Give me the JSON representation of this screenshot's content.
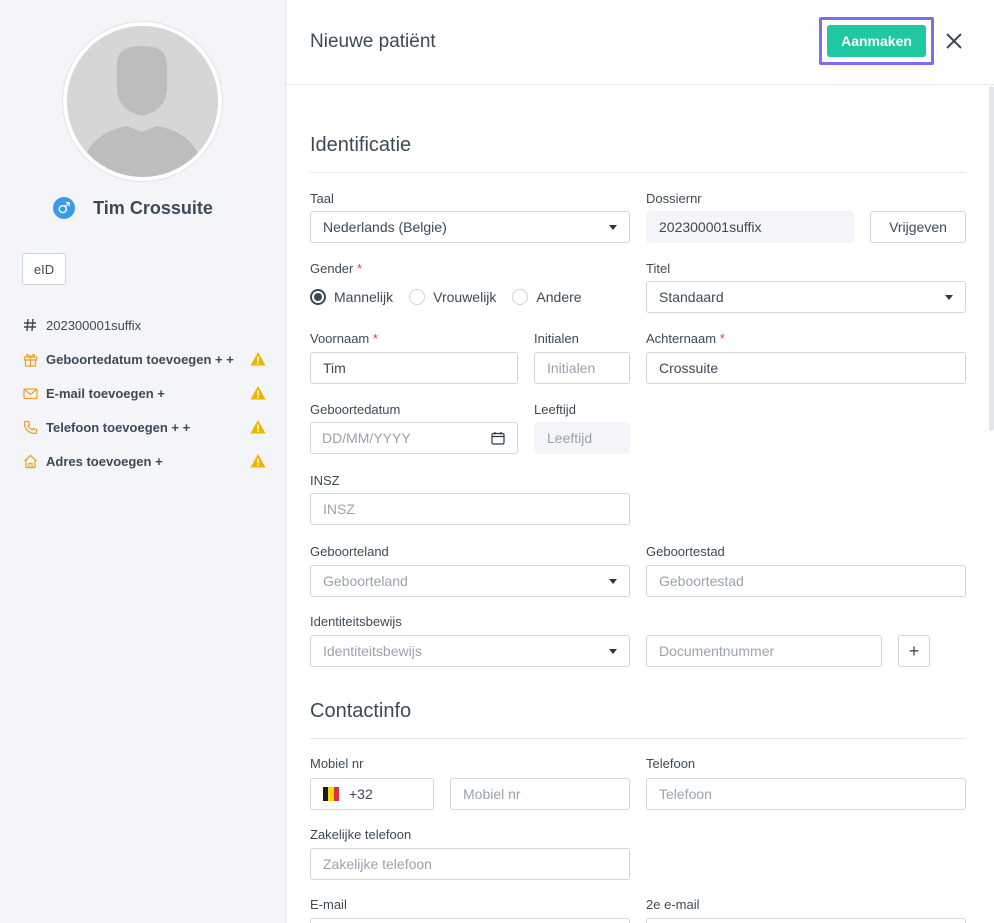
{
  "sidebar": {
    "patient_name": "Tim Crossuite",
    "gender_symbol": "♂",
    "eid_label": "eID",
    "items": [
      {
        "icon": "hash-icon",
        "label": "202300001suffix",
        "warning": false,
        "bold": false
      },
      {
        "icon": "gift-icon",
        "label": "Geboortedatum toevoegen + +",
        "warning": true,
        "bold": true
      },
      {
        "icon": "mail-icon",
        "label": "E-mail toevoegen +",
        "warning": true,
        "bold": true
      },
      {
        "icon": "phone-icon",
        "label": "Telefoon toevoegen + +",
        "warning": true,
        "bold": true
      },
      {
        "icon": "home-icon",
        "label": "Adres toevoegen +",
        "warning": true,
        "bold": true
      }
    ]
  },
  "header": {
    "title": "Nieuwe patiënt",
    "create_label": "Aanmaken"
  },
  "identification": {
    "title": "Identificatie",
    "language": {
      "label": "Taal",
      "value": "Nederlands (Belgie)"
    },
    "file_nr": {
      "label": "Dossiernr",
      "value": "202300001suffix",
      "release_label": "Vrijgeven"
    },
    "gender": {
      "label": "Gender",
      "required": "*",
      "options": [
        "Mannelijk",
        "Vrouwelijk",
        "Andere"
      ],
      "selected": "Mannelijk"
    },
    "title_field": {
      "label": "Titel",
      "value": "Standaard"
    },
    "first_name": {
      "label": "Voornaam",
      "required": "*",
      "value": "Tim"
    },
    "initials": {
      "label": "Initialen",
      "placeholder": "Initialen"
    },
    "last_name": {
      "label": "Achternaam",
      "required": "*",
      "value": "Crossuite"
    },
    "birth_date": {
      "label": "Geboortedatum",
      "placeholder": "DD/MM/YYYY"
    },
    "age": {
      "label": "Leeftijd",
      "placeholder": "Leeftijd"
    },
    "insz": {
      "label": "INSZ",
      "placeholder": "INSZ"
    },
    "birth_country": {
      "label": "Geboorteland",
      "placeholder": "Geboorteland"
    },
    "birth_place": {
      "label": "Geboortestad",
      "placeholder": "Geboortestad"
    },
    "id_card": {
      "label": "Identiteitsbewijs",
      "placeholder": "Identiteitsbewijs"
    },
    "doc_nr": {
      "placeholder": "Documentnummer"
    },
    "add_symbol": "+"
  },
  "contact": {
    "title": "Contactinfo",
    "mobile": {
      "label": "Mobiel nr",
      "prefix": "+32",
      "placeholder": "Mobiel nr"
    },
    "phone": {
      "label": "Telefoon",
      "placeholder": "Telefoon"
    },
    "work_phone": {
      "label": "Zakelijke telefoon",
      "placeholder": "Zakelijke telefoon"
    },
    "email": {
      "label": "E-mail"
    },
    "email2": {
      "label": "2e e-mail"
    }
  },
  "colors": {
    "accent": "#1fc8a0",
    "focus_outline": "#7b6cf0",
    "warning": "#f0b400",
    "icon_orange": "#f0a020",
    "gender_blue": "#3d9ae8",
    "required_red": "#e04545"
  }
}
